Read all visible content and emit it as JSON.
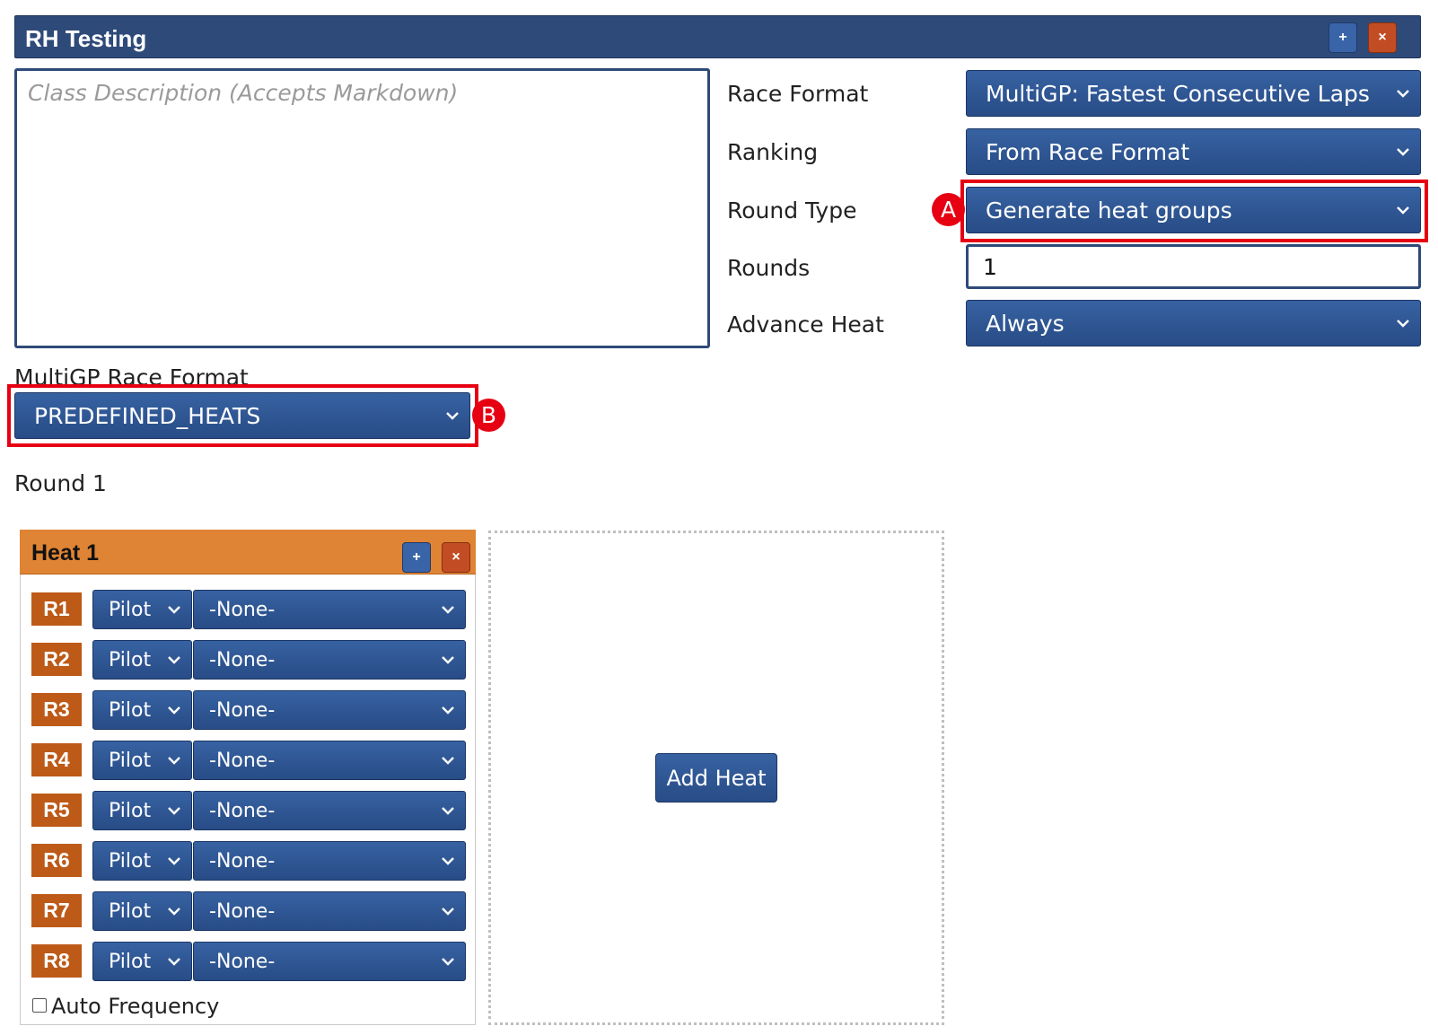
{
  "class": {
    "title": "RH Testing",
    "add_label": "+",
    "delete_label": "×",
    "description_placeholder": "Class Description (Accepts Markdown)"
  },
  "fields": {
    "race_format": {
      "label": "Race Format",
      "value": "MultiGP: Fastest Consecutive Laps"
    },
    "ranking": {
      "label": "Ranking",
      "value": "From Race Format"
    },
    "round_type": {
      "label": "Round Type",
      "value": "Generate heat groups"
    },
    "rounds": {
      "label": "Rounds",
      "value": "1"
    },
    "advance_heat": {
      "label": "Advance Heat",
      "value": "Always"
    }
  },
  "multigp": {
    "label": "MultiGP Race Format",
    "value": "PREDEFINED_HEATS"
  },
  "annotations": {
    "a": "A",
    "b": "B"
  },
  "round": {
    "label": "Round 1"
  },
  "heat": {
    "title": "Heat 1",
    "add_label": "+",
    "delete_label": "×",
    "slots": [
      {
        "node": "R1",
        "method": "Pilot",
        "pilot": "-None-"
      },
      {
        "node": "R2",
        "method": "Pilot",
        "pilot": "-None-"
      },
      {
        "node": "R3",
        "method": "Pilot",
        "pilot": "-None-"
      },
      {
        "node": "R4",
        "method": "Pilot",
        "pilot": "-None-"
      },
      {
        "node": "R5",
        "method": "Pilot",
        "pilot": "-None-"
      },
      {
        "node": "R6",
        "method": "Pilot",
        "pilot": "-None-"
      },
      {
        "node": "R7",
        "method": "Pilot",
        "pilot": "-None-"
      },
      {
        "node": "R8",
        "method": "Pilot",
        "pilot": "-None-"
      }
    ],
    "auto_frequency_label": "Auto Frequency",
    "auto_frequency_checked": false
  },
  "add_heat_label": "Add Heat",
  "colors": {
    "primary": "#2e4a79",
    "button_blue": "#3762a2",
    "danger": "#c24d24",
    "heat_header": "#de8434",
    "node_badge": "#bd5a18",
    "highlight": "#e60012"
  }
}
